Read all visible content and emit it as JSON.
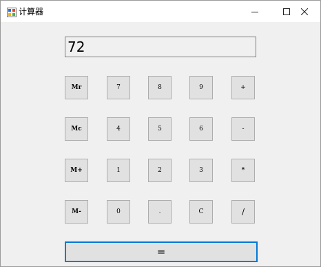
{
  "window": {
    "title": "计算器",
    "icon": "calculator-app-icon"
  },
  "caption": {
    "minimize_icon": "minimize-icon",
    "maximize_icon": "maximize-icon",
    "close_icon": "close-icon"
  },
  "display": {
    "value": "72"
  },
  "keys": {
    "mr": "Mr",
    "mc": "Mc",
    "mplus": "M+",
    "mminus": "M-",
    "seven": "7",
    "eight": "8",
    "nine": "9",
    "four": "4",
    "five": "5",
    "six": "6",
    "one": "1",
    "two": "2",
    "three": "3",
    "zero": "0",
    "dot": ".",
    "clear": "C",
    "plus": "+",
    "minus": "-",
    "multiply": "*",
    "divide": "/",
    "equals": "="
  },
  "colors": {
    "window_bg": "#f0f0f0",
    "button_bg": "#e1e1e1",
    "button_border": "#adadad",
    "focus_border": "#0078d7"
  }
}
